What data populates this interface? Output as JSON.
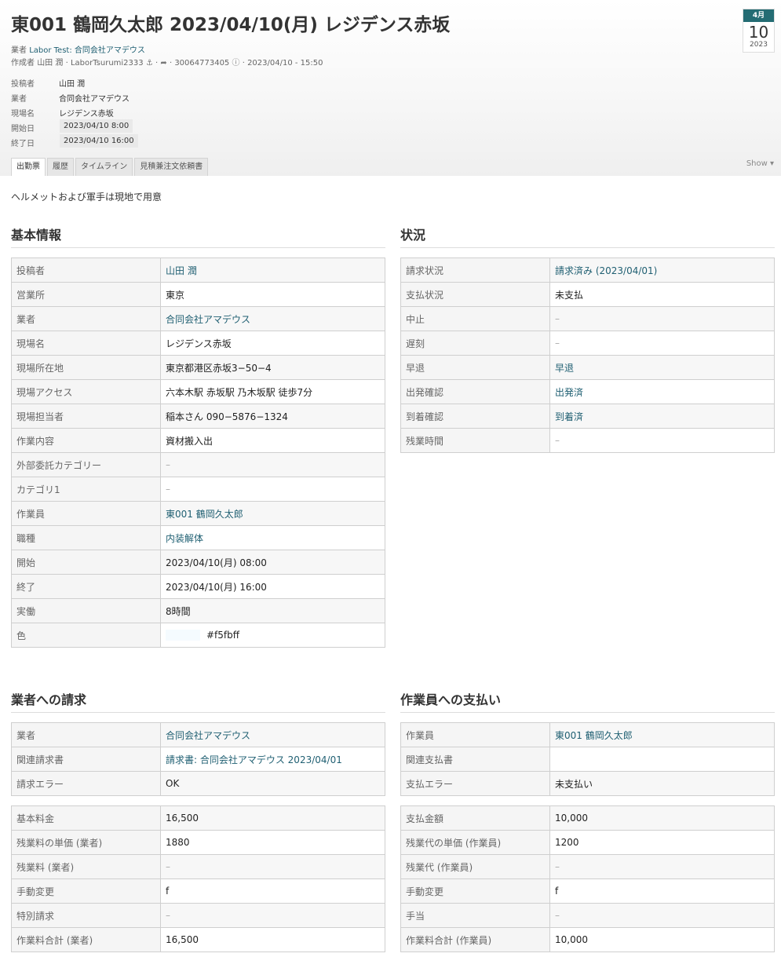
{
  "header": {
    "title": "東001 鶴岡久太郎 2023/04/10(月) レジデンス赤坂",
    "vendor_label": "業者",
    "vendor_link": "Labor Test: 合同会社アマデウス",
    "author_label": "作成者",
    "author_name": "山田 潤",
    "author_login": "LaborTsurumi2333",
    "record_id": "30064773405",
    "created_at": "2023/04/10 - 15:50",
    "sep": "·"
  },
  "calendar": {
    "month": "4月",
    "day": "10",
    "year": "2023"
  },
  "meta": [
    {
      "key": "投稿者",
      "value": "山田 潤",
      "type": "link"
    },
    {
      "key": "業者",
      "value": "合同会社アマデウス",
      "type": "link"
    },
    {
      "key": "現場名",
      "value": "レジデンス赤坂",
      "type": "text"
    },
    {
      "key": "開始日",
      "value": "2023/04/10 8:00",
      "type": "pill"
    },
    {
      "key": "終了日",
      "value": "2023/04/10 16:00",
      "type": "pill"
    }
  ],
  "tabs": [
    {
      "label": "出勤票",
      "active": true
    },
    {
      "label": "履歴",
      "active": false
    },
    {
      "label": "タイムライン",
      "active": false
    },
    {
      "label": "見積兼注文依頼書",
      "active": false
    }
  ],
  "show_toggle": "Show ▾",
  "note": "ヘルメットおよび軍手は現地で用意",
  "sections": {
    "basic": {
      "title": "基本情報",
      "rows": [
        {
          "key": "投稿者",
          "value": "山田 潤",
          "type": "link"
        },
        {
          "key": "営業所",
          "value": "東京",
          "type": "text"
        },
        {
          "key": "業者",
          "value": "合同会社アマデウス",
          "type": "link"
        },
        {
          "key": "現場名",
          "value": "レジデンス赤坂",
          "type": "text"
        },
        {
          "key": "現場所在地",
          "value": "東京都港区赤坂3−50−4",
          "type": "text"
        },
        {
          "key": "現場アクセス",
          "value": "六本木駅 赤坂駅 乃木坂駅 徒歩7分",
          "type": "text"
        },
        {
          "key": "現場担当者",
          "value": "稲本さん 090−5876−1324",
          "type": "text"
        },
        {
          "key": "作業内容",
          "value": "資材搬入出",
          "type": "text"
        },
        {
          "key": "外部委託カテゴリー",
          "value": "–",
          "type": "dash"
        },
        {
          "key": "カテゴリ1",
          "value": "–",
          "type": "dash"
        },
        {
          "key": "作業員",
          "value": "東001 鶴岡久太郎",
          "type": "link"
        },
        {
          "key": "職種",
          "value": "内装解体",
          "type": "link"
        },
        {
          "key": "開始",
          "value": "2023/04/10(月) 08:00",
          "type": "text"
        },
        {
          "key": "終了",
          "value": "2023/04/10(月) 16:00",
          "type": "text"
        },
        {
          "key": "実働",
          "value": "8時間",
          "type": "text"
        },
        {
          "key": "色",
          "value": "#f5fbff",
          "type": "color",
          "color": "#f5fbff"
        }
      ]
    },
    "status": {
      "title": "状況",
      "rows": [
        {
          "key": "請求状況",
          "value": "請求済み (2023/04/01)",
          "type": "link"
        },
        {
          "key": "支払状況",
          "value": "未支払",
          "type": "text"
        },
        {
          "key": "中止",
          "value": "–",
          "type": "dash"
        },
        {
          "key": "遅刻",
          "value": "–",
          "type": "dash"
        },
        {
          "key": "早退",
          "value": "早退",
          "type": "link"
        },
        {
          "key": "出発確認",
          "value": "出発済",
          "type": "link"
        },
        {
          "key": "到着確認",
          "value": "到着済",
          "type": "link"
        },
        {
          "key": "残業時間",
          "value": "–",
          "type": "dash"
        }
      ]
    },
    "billing": {
      "title": "業者への請求",
      "rows_a": [
        {
          "key": "業者",
          "value": "合同会社アマデウス",
          "type": "link"
        },
        {
          "key": "関連請求書",
          "value": "請求書: 合同会社アマデウス 2023/04/01",
          "type": "link"
        },
        {
          "key": "請求エラー",
          "value": "OK",
          "type": "text"
        }
      ],
      "rows_b": [
        {
          "key": "基本料金",
          "value": "16,500",
          "type": "text"
        },
        {
          "key": "残業料の単価 (業者)",
          "value": "1880",
          "type": "text"
        },
        {
          "key": "残業料 (業者)",
          "value": "–",
          "type": "dash"
        },
        {
          "key": "手動変更",
          "value": "f",
          "type": "text"
        },
        {
          "key": "特別請求",
          "value": "–",
          "type": "dash"
        },
        {
          "key": "作業料合計 (業者)",
          "value": "16,500",
          "type": "text"
        }
      ]
    },
    "payment": {
      "title": "作業員への支払い",
      "rows_a": [
        {
          "key": "作業員",
          "value": "東001 鶴岡久太郎",
          "type": "link"
        },
        {
          "key": "関連支払書",
          "value": "",
          "type": "text"
        },
        {
          "key": "支払エラー",
          "value": "未支払い",
          "type": "text"
        }
      ],
      "rows_b": [
        {
          "key": "支払金額",
          "value": "10,000",
          "type": "text"
        },
        {
          "key": "残業代の単価 (作業員)",
          "value": "1200",
          "type": "text"
        },
        {
          "key": "残業代 (作業員)",
          "value": "–",
          "type": "dash"
        },
        {
          "key": "手動変更",
          "value": "f",
          "type": "text"
        },
        {
          "key": "手当",
          "value": "–",
          "type": "dash"
        },
        {
          "key": "作業料合計 (作業員)",
          "value": "10,000",
          "type": "text"
        }
      ]
    }
  }
}
